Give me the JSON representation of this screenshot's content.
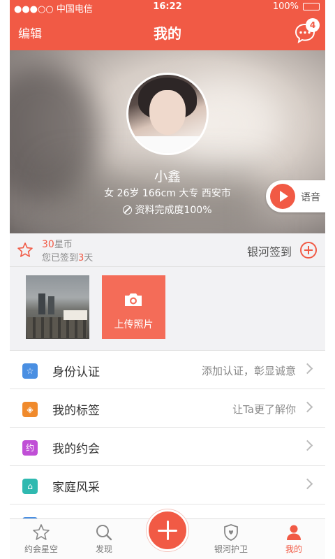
{
  "status_bar": {
    "carrier": "●●●○○ 中国电信",
    "time": "16:22",
    "battery": "100%"
  },
  "nav": {
    "edit": "编辑",
    "title": "我的",
    "message_badge": "4"
  },
  "profile": {
    "name": "小鑫",
    "info": "女 26岁 166cm 大专 西安市",
    "completeness": "资料完成度100%",
    "voice_label": "语音"
  },
  "checkin": {
    "coins_value": "30",
    "coins_unit": "星币",
    "signed_prefix": "您已签到",
    "signed_days": "3",
    "signed_suffix": "天",
    "galaxy_sign": "银河签到"
  },
  "photos": {
    "upload_label": "上传照片"
  },
  "list": [
    {
      "label": "身份认证",
      "hint": "添加认证，彰显诚意",
      "icon": "star-icon",
      "color": "#4a8fe2",
      "glyph": "☆"
    },
    {
      "label": "我的标签",
      "hint": "让Ta更了解你",
      "icon": "tag-icon",
      "color": "#f08a2c",
      "glyph": "◈"
    },
    {
      "label": "我的约会",
      "hint": "",
      "icon": "date-icon",
      "color": "#c04fd6",
      "glyph": "约"
    },
    {
      "label": "家庭风采",
      "hint": "",
      "icon": "home-icon",
      "color": "#2fb9b0",
      "glyph": "⌂"
    }
  ],
  "tabs": [
    {
      "label": "约会星空",
      "icon": "star-icon"
    },
    {
      "label": "发现",
      "icon": "search-icon"
    },
    {
      "label": "银河护卫",
      "icon": "shield-icon"
    },
    {
      "label": "我的",
      "icon": "person-icon"
    }
  ],
  "colors": {
    "accent": "#f15a45",
    "background": "#f2f2f4"
  }
}
